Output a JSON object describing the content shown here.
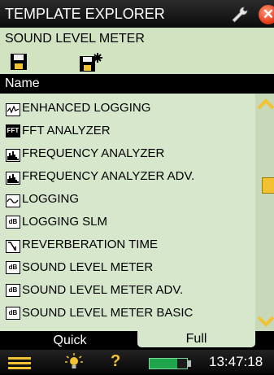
{
  "title_bar": {
    "title": "TEMPLATE EXPLORER",
    "wrench_icon": "wrench-icon",
    "close_icon": "close-icon",
    "close_color": "#e8411f"
  },
  "subtitle": "SOUND LEVEL METER",
  "toolbar": {
    "save_icon": "save-icon",
    "save_as_icon": "save-as-icon"
  },
  "list_header": "Name",
  "templates": [
    {
      "label": "ENHANCED LOGGING",
      "icon": "enhanced-logging-icon"
    },
    {
      "label": "FFT ANALYZER",
      "icon": "fft-icon",
      "icon_text": "FFT"
    },
    {
      "label": "FREQUENCY ANALYZER",
      "icon": "frequency-bars-icon"
    },
    {
      "label": "FREQUENCY ANALYZER ADV.",
      "icon": "frequency-bars-icon"
    },
    {
      "label": "LOGGING",
      "icon": "logging-wave-icon"
    },
    {
      "label": "LOGGING SLM",
      "icon": "logging-slm-icon",
      "icon_text": "dB"
    },
    {
      "label": "REVERBERATION TIME",
      "icon": "reverberation-icon"
    },
    {
      "label": "SOUND LEVEL METER",
      "icon": "db-icon",
      "icon_text": "dB"
    },
    {
      "label": "SOUND LEVEL METER ADV.",
      "icon": "db-icon",
      "icon_text": "dB"
    },
    {
      "label": "SOUND LEVEL METER BASIC",
      "icon": "db-icon",
      "icon_text": "dB"
    }
  ],
  "tabs": {
    "quick": "Quick",
    "full": "Full",
    "active": "Full"
  },
  "status_bar": {
    "clock": "13:47:18",
    "menu_icon": "menu-icon",
    "light_icon": "lightbulb-icon",
    "help_icon": "help-icon",
    "help_text": "?",
    "battery_icon": "battery-icon"
  },
  "colors": {
    "panel": "#d6e7cb",
    "accent": "#f1c232",
    "battery": "#1fa54c"
  }
}
